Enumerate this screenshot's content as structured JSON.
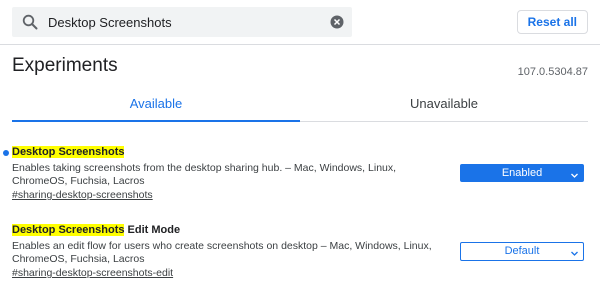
{
  "search": {
    "value": "Desktop Screenshots",
    "placeholder": "Search flags"
  },
  "header": {
    "reset_label": "Reset all"
  },
  "page": {
    "title": "Experiments",
    "version": "107.0.5304.87"
  },
  "tabs": [
    {
      "label": "Available",
      "active": true
    },
    {
      "label": "Unavailable",
      "active": false
    }
  ],
  "experiments": [
    {
      "title_highlight": "Desktop Screenshots",
      "title_rest": "",
      "description": "Enables taking screenshots from the desktop sharing hub. – Mac, Windows, Linux, ChromeOS, Fuchsia, Lacros",
      "link": "#sharing-desktop-screenshots",
      "state": "Enabled",
      "modified": true
    },
    {
      "title_highlight": "Desktop Screenshots",
      "title_rest": " Edit Mode",
      "description": "Enables an edit flow for users who create screenshots on desktop – Mac, Windows, Linux, ChromeOS, Fuchsia, Lacros",
      "link": "#sharing-desktop-screenshots-edit",
      "state": "Default",
      "modified": false
    }
  ],
  "colors": {
    "accent": "#1a73e8",
    "highlight": "#ffff00",
    "text": "#202124",
    "muted": "#5f6368"
  }
}
